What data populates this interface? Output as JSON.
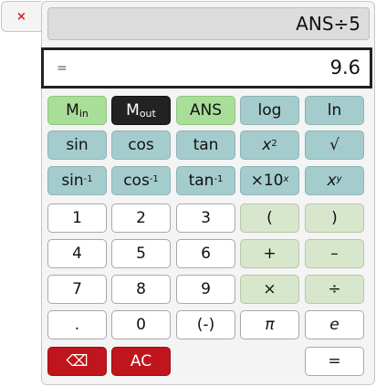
{
  "window": {
    "close_glyph": "×"
  },
  "display": {
    "expression": "ANS÷5",
    "result_prefix": "=",
    "result_value": "9.6"
  },
  "memory": {
    "min_main": "M",
    "min_sub": "in",
    "mout_main": "M",
    "mout_sub": "out",
    "ans": "ANS"
  },
  "functions": {
    "log": "log",
    "ln": "ln",
    "sin": "sin",
    "cos": "cos",
    "tan": "tan",
    "square_base": "x",
    "square_exp": "2",
    "sqrt": "√",
    "asin_base": "sin",
    "asin_exp": "-1",
    "acos_base": "cos",
    "acos_exp": "-1",
    "atan_base": "tan",
    "atan_exp": "-1",
    "exp10_base": "×10",
    "exp10_exp": "x",
    "power_base": "x",
    "power_exp": "y"
  },
  "keys": {
    "d1": "1",
    "d2": "2",
    "d3": "3",
    "d4": "4",
    "d5": "5",
    "d6": "6",
    "d7": "7",
    "d8": "8",
    "d9": "9",
    "d0": "0",
    "dot": ".",
    "negate": "(-)",
    "paren_open": "(",
    "paren_close": ")",
    "plus": "+",
    "minus": "–",
    "times": "×",
    "divide": "÷",
    "pi": "π",
    "e": "e",
    "backspace": "⌫",
    "clear": "AC",
    "equals": "="
  },
  "colors": {
    "teal_key": "#a4cccc",
    "light_green_key": "#a8de98",
    "pale_green_key": "#d8e6cc",
    "dark_key": "#222222",
    "red_key": "#c0151c",
    "close_icon": "#d02020"
  }
}
